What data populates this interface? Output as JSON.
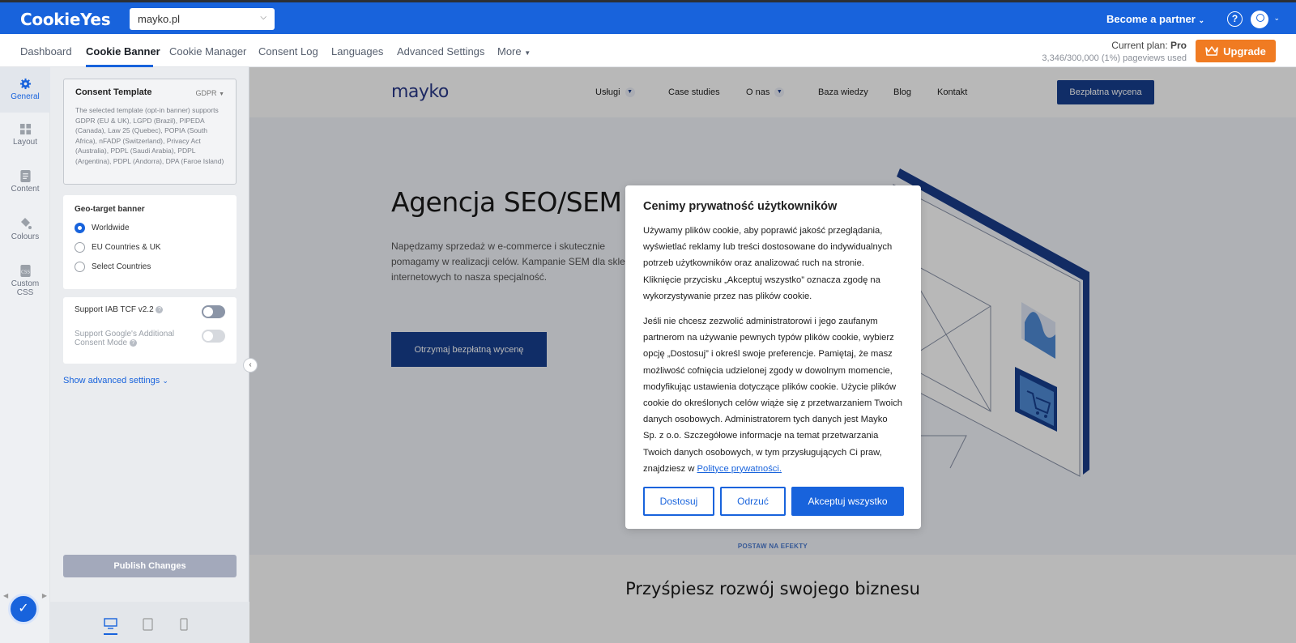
{
  "app": {
    "brand": "CookieYes",
    "site_selector": "mayko.pl",
    "become_partner": "Become a partner",
    "help_icon": "question-circle-icon",
    "account_icon": "user-avatar-icon"
  },
  "nav": {
    "tabs": [
      "Dashboard",
      "Cookie Banner",
      "Cookie Manager",
      "Consent Log",
      "Languages",
      "Advanced Settings",
      "More"
    ],
    "active": "Cookie Banner"
  },
  "plan": {
    "label": "Current plan: ",
    "name": "Pro",
    "usage": "3,346/300,000 (1%) pageviews used",
    "upgrade": "Upgrade"
  },
  "rail": {
    "general": "General",
    "layout": "Layout",
    "content": "Content",
    "colours": "Colours",
    "custom_css_1": "Custom",
    "custom_css_2": "CSS"
  },
  "panel": {
    "template_title": "Consent Template",
    "template_type": "GDPR",
    "template_desc": "The selected template (opt-in banner) supports GDPR (EU & UK), LGPD (Brazil), PIPEDA (Canada), Law 25 (Quebec), POPIA (South Africa), nFADP (Switzerland), Privacy Act (Australia), PDPL (Saudi Arabia), PDPL (Argentina), PDPL (Andorra), DPA (Faroe Island)",
    "geo_title": "Geo-target banner",
    "geo_options": [
      "Worldwide",
      "EU Countries & UK",
      "Select Countries"
    ],
    "geo_selected": "Worldwide",
    "iab_label": "Support IAB TCF v2.2",
    "google_label_1": "Support Google's Additional",
    "google_label_2": "Consent Mode",
    "advanced_link": "Show advanced settings",
    "publish": "Publish Changes"
  },
  "site": {
    "logo": "mayko",
    "nav": [
      "Usługi",
      "Case studies",
      "O nas",
      "Baza wiedzy",
      "Blog",
      "Kontakt"
    ],
    "cta": "Bezpłatna wycena",
    "h1": "Agencja SEO/SEM",
    "p": "Napędzamy sprzedaż w e-commerce i skutecznie pomagamy w realizacji celów. Kampanie SEM dla sklep internetowych to nasza specjalność.",
    "hero_button": "Otrzymaj bezpłatną wycenę",
    "kicker": "POSTAW NA EFEKTY",
    "section_title": "Przyśpiesz rozwój swojego biznesu"
  },
  "banner": {
    "title": "Cenimy prywatność użytkowników",
    "p1": "Używamy plików cookie, aby poprawić jakość przeglądania, wyświetlać reklamy lub treści dostosowane do indywidualnych potrzeb użytkowników oraz analizować ruch na stronie. Kliknięcie przycisku „Akceptuj wszystko” oznacza zgodę na wykorzystywanie przez nas plików cookie.",
    "p2": "Jeśli nie chcesz zezwolić administratorowi i jego zaufanym partnerom na używanie pewnych typów plików cookie, wybierz opcję „Dostosuj” i określ swoje preferencje. Pamiętaj, że masz możliwość cofnięcia udzielonej zgody w dowolnym momencie, modyfikując ustawienia dotyczące plików cookie. Użycie plików cookie do określonych celów wiąże się z przetwarzaniem Twoich danych osobowych. Administratorem tych danych jest Mayko Sp. z o.o. Szczegółowe informacje na temat przetwarzania Twoich danych osobowych, w tym przysługujących Ci praw, znajdziesz w ",
    "link": "Polityce prywatności.",
    "btn_customize": "Dostosuj",
    "btn_reject": "Odrzuć",
    "btn_accept": "Akceptuj wszystko"
  }
}
